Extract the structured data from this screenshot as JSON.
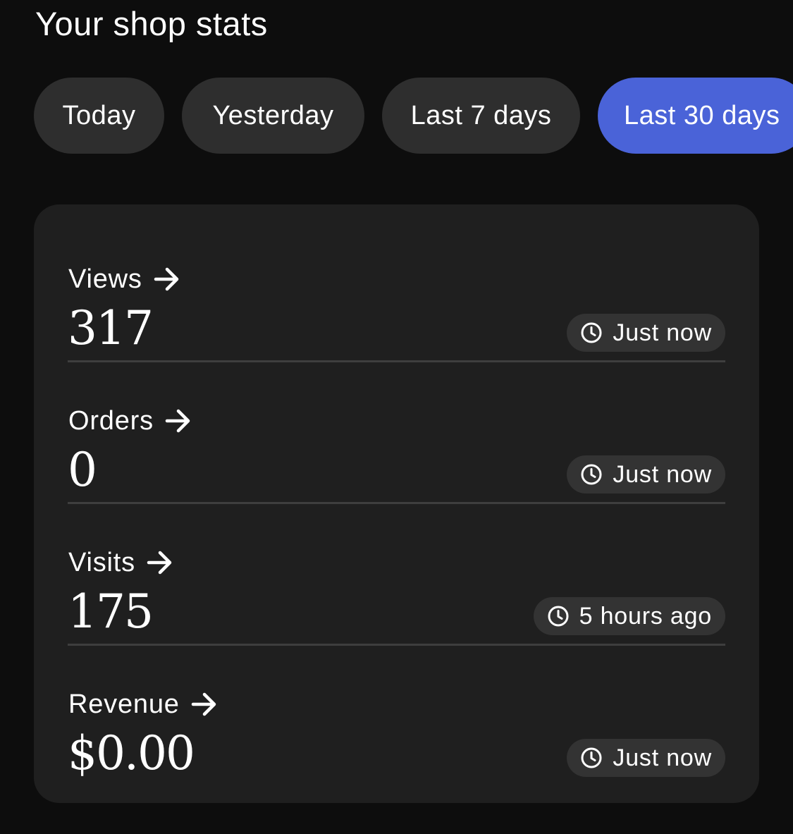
{
  "page": {
    "title": "Your shop stats"
  },
  "tabs": [
    {
      "label": "Today",
      "active": false
    },
    {
      "label": "Yesterday",
      "active": false
    },
    {
      "label": "Last 7 days",
      "active": false
    },
    {
      "label": "Last 30 days",
      "active": true
    }
  ],
  "stats": [
    {
      "label": "Views",
      "value": "317",
      "updated": "Just now",
      "icon": "arrow-right-icon"
    },
    {
      "label": "Orders",
      "value": "0",
      "updated": "Just now",
      "icon": "arrow-right-icon"
    },
    {
      "label": "Visits",
      "value": "175",
      "updated": "5 hours ago",
      "icon": "arrow-right-icon"
    },
    {
      "label": "Revenue",
      "value": "$0.00",
      "updated": "Just now",
      "icon": "arrow-right-icon"
    }
  ],
  "colors": {
    "background": "#0d0d0d",
    "card": "#1f1f1f",
    "tab": "#2e2e2e",
    "active_tab": "#4a63d8",
    "badge": "#333333",
    "divider": "#3e3e3e",
    "text": "#ffffff"
  },
  "icons": {
    "timestamp": "clock-icon",
    "stat_link": "arrow-right-icon"
  }
}
